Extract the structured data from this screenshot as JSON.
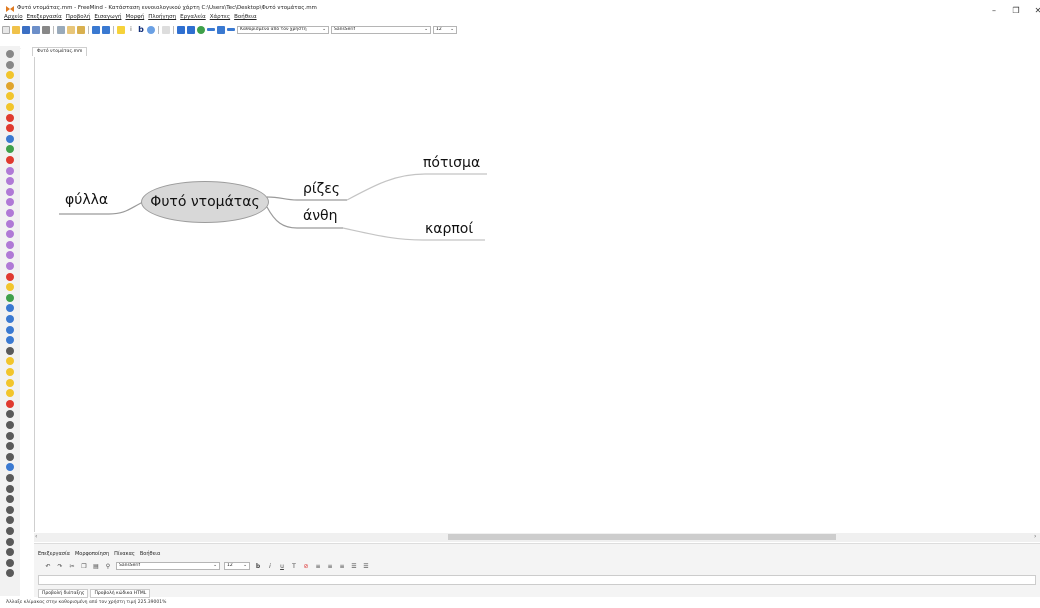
{
  "window": {
    "title": "Φυτό ντομάτας.mm - FreeMind - Κατάσταση εννοιολογικού χάρτη C:\\Users\\Tec\\Desktop\\Φυτό ντομάτας.mm",
    "minimize_glyph": "–",
    "restore_glyph": "❐",
    "close_glyph": "✕"
  },
  "menubar": [
    "Αρχείο",
    "Επεξεργασία",
    "Προβολή",
    "Εισαγωγή",
    "Μορφή",
    "Πλοήγηση",
    "Εργαλεία",
    "Χάρτες",
    "Βοήθεια"
  ],
  "toolbar": {
    "style_select": "Καθορισμένο από τον χρήστη",
    "font_select": "SansSerif",
    "size_select": "12"
  },
  "tab": {
    "label": "Φυτό ντομάτας.mm"
  },
  "mindmap": {
    "root": "Φυτό ντομάτας",
    "left_child": "φύλλα",
    "right_children": [
      "ρίζες",
      "άνθη"
    ],
    "grandchildren": [
      "πότισμα",
      "καρποί"
    ]
  },
  "editor": {
    "menu": [
      "Επεξεργασία",
      "Μορφοποίηση",
      "Πίνακας",
      "Βοήθεια"
    ],
    "font": "SansSerif",
    "size": "12",
    "tabs": [
      "Προβολή διάταξης",
      "Προβολή κώδικα HTML"
    ]
  },
  "status": "Άλλαξε κλίμακας στην καθορισμένη από τον χρήστη τιμή 225.39001%",
  "palette_icons": [
    "close-icon",
    "window-icon",
    "idea-icon",
    "question-icon",
    "exclamation-icon",
    "warning-icon",
    "stop-icon",
    "stop-icon",
    "info-icon",
    "check-icon",
    "cross-icon",
    "digit-1-icon",
    "digit-2-icon",
    "digit-3-icon",
    "digit-4-icon",
    "digit-5-icon",
    "digit-6-icon",
    "digit-7-icon",
    "digit-8-icon",
    "digit-9-icon",
    "digit-10-icon",
    "traffic-light-red-icon",
    "traffic-light-yellow-icon",
    "traffic-light-green-icon",
    "back-icon",
    "forward-icon",
    "up-icon",
    "down-icon",
    "pencil-icon",
    "smiley-good-icon",
    "smiley-neutral-icon",
    "smiley-bad-icon",
    "smiley-oh-icon",
    "smiley-angry-icon",
    "ball-icon",
    "bookmark-icon",
    "home-icon",
    "calendar-icon",
    "camera-icon",
    "mail-icon",
    "people-icon",
    "list-icon",
    "document-icon",
    "wizard-icon",
    "music-icon",
    "flag-icon",
    "key-icon",
    "magnifier-icon",
    "bell-icon",
    "star-icon"
  ]
}
